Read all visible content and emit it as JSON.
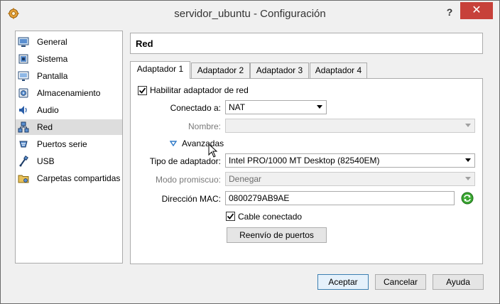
{
  "window": {
    "title": "servidor_ubuntu - Configuración",
    "help_label": "?",
    "close_label": "✕"
  },
  "sidebar": {
    "items": [
      {
        "label": "General",
        "icon": "general-icon"
      },
      {
        "label": "Sistema",
        "icon": "system-icon"
      },
      {
        "label": "Pantalla",
        "icon": "display-icon"
      },
      {
        "label": "Almacenamiento",
        "icon": "storage-icon"
      },
      {
        "label": "Audio",
        "icon": "audio-icon"
      },
      {
        "label": "Red",
        "icon": "network-icon",
        "selected": true
      },
      {
        "label": "Puertos serie",
        "icon": "serial-ports-icon"
      },
      {
        "label": "USB",
        "icon": "usb-icon"
      },
      {
        "label": "Carpetas compartidas",
        "icon": "shared-folders-icon"
      }
    ]
  },
  "main": {
    "section_title": "Red",
    "tabs": [
      {
        "label": "Adaptador 1",
        "active": true
      },
      {
        "label": "Adaptador 2"
      },
      {
        "label": "Adaptador 3"
      },
      {
        "label": "Adaptador 4"
      }
    ],
    "enable_adapter_label": "Habilitar adaptador de red",
    "enable_adapter_checked": true,
    "attached_to_label": "Conectado a:",
    "attached_to_value": "NAT",
    "name_label": "Nombre:",
    "name_value": "",
    "advanced_label": "Avanzadas",
    "adapter_type_label": "Tipo de adaptador:",
    "adapter_type_value": "Intel PRO/1000 MT Desktop (82540EM)",
    "promisc_label": "Modo promiscuo:",
    "promisc_value": "Denegar",
    "mac_label": "Dirección MAC:",
    "mac_value": "0800279AB9AE",
    "cable_label": "Cable conectado",
    "cable_checked": true,
    "port_forwarding_label": "Reenvío de puertos"
  },
  "footer": {
    "ok_label": "Aceptar",
    "cancel_label": "Cancelar",
    "help_label": "Ayuda"
  },
  "colors": {
    "close_button": "#c7413a",
    "default_button_border": "#3c7fb1",
    "refresh_icon": "#3aa832"
  }
}
